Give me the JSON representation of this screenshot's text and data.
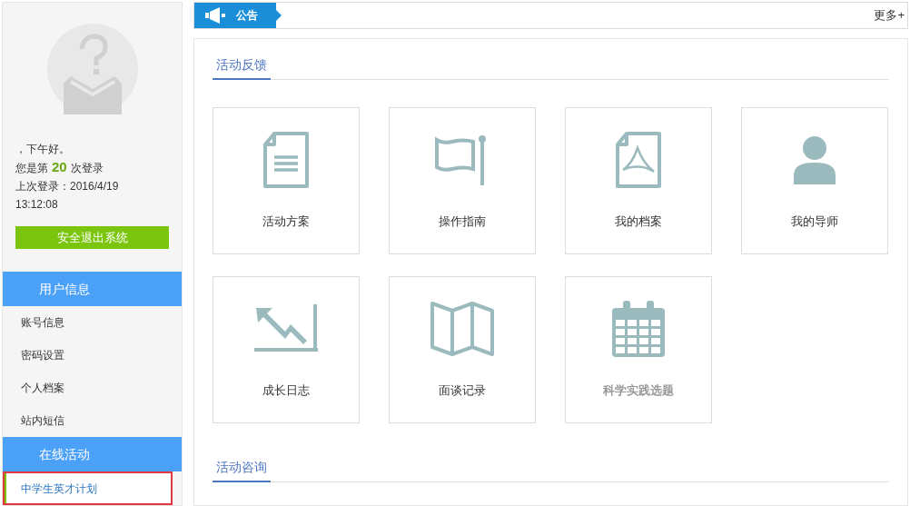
{
  "user": {
    "greeting": "，下午好。",
    "login_prefix": "您是第",
    "login_count": "20",
    "login_suffix": "次登录",
    "last_login": "上次登录：2016/4/19 13:12:08",
    "logout": "安全退出系统"
  },
  "menu": [
    {
      "title": "用户信息",
      "items": [
        {
          "label": "账号信息",
          "selected": false
        },
        {
          "label": "密码设置",
          "selected": false
        },
        {
          "label": "个人档案",
          "selected": false
        },
        {
          "label": "站内短信",
          "selected": false
        }
      ]
    },
    {
      "title": "在线活动",
      "items": [
        {
          "label": "中学生英才计划",
          "selected": true
        }
      ]
    }
  ],
  "notice": {
    "label": "公告",
    "more": "更多+"
  },
  "sections": [
    {
      "title": "活动反馈",
      "tiles": [
        {
          "kind": "document",
          "label": "活动方案",
          "disabled": false
        },
        {
          "kind": "flag",
          "label": "操作指南",
          "disabled": false
        },
        {
          "kind": "pdf",
          "label": "我的档案",
          "disabled": false
        },
        {
          "kind": "person",
          "label": "我的导师",
          "disabled": false
        },
        {
          "kind": "chart",
          "label": "成长日志",
          "disabled": false
        },
        {
          "kind": "map",
          "label": "面谈记录",
          "disabled": false
        },
        {
          "kind": "calendar",
          "label": "科学实践选题",
          "disabled": true
        }
      ]
    },
    {
      "title": "活动咨询"
    }
  ]
}
